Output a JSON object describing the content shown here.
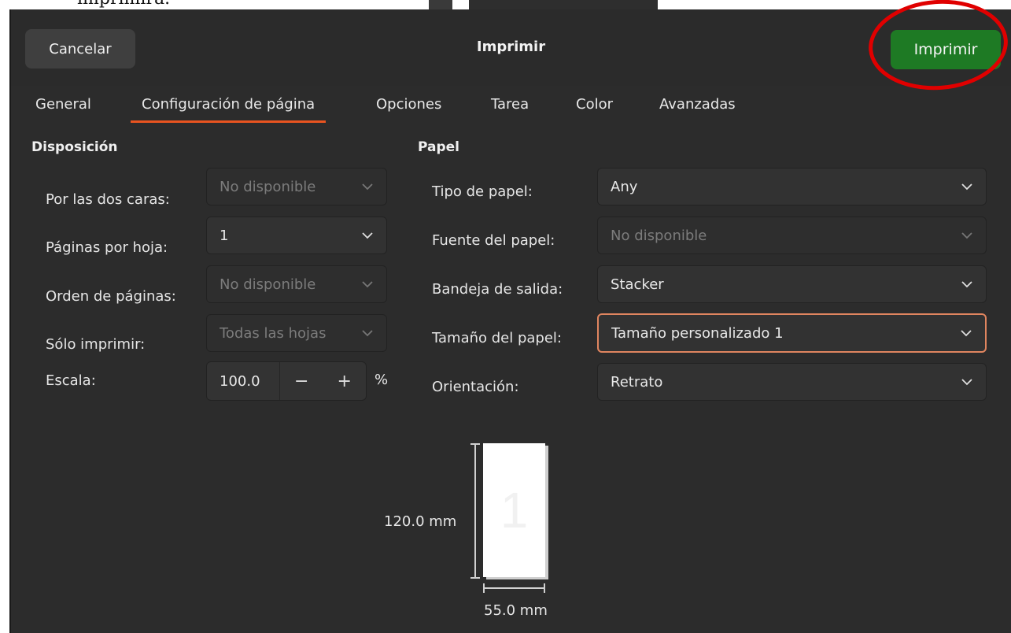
{
  "background": {
    "doc_text": "imprimirá."
  },
  "dialog": {
    "title": "Imprimir",
    "cancel_label": "Cancelar",
    "print_label": "Imprimir",
    "accent_color": "#e95420",
    "print_button_color": "#1e7a24",
    "highlight_color": "#e00000"
  },
  "tabs": [
    {
      "label": "General",
      "active": false
    },
    {
      "label": "Configuración de página",
      "active": true
    },
    {
      "label": "Opciones",
      "active": false
    },
    {
      "label": "Tarea",
      "active": false
    },
    {
      "label": "Color",
      "active": false
    },
    {
      "label": "Avanzadas",
      "active": false
    }
  ],
  "layout_section": {
    "title": "Disposición",
    "two_sided": {
      "label": "Por las dos caras:",
      "value": "No disponible",
      "disabled": true
    },
    "pages_per_sheet": {
      "label": "Páginas por hoja:",
      "value": "1",
      "disabled": false
    },
    "page_order": {
      "label": "Orden de páginas:",
      "value": "No disponible",
      "disabled": true
    },
    "only_print": {
      "label": "Sólo imprimir:",
      "value": "Todas las hojas",
      "disabled": true
    },
    "scale": {
      "label": "Escala:",
      "value": "100.0",
      "minus": "−",
      "plus": "+",
      "unit": "%"
    }
  },
  "paper_section": {
    "title": "Papel",
    "paper_type": {
      "label": "Tipo de papel:",
      "value": "Any",
      "disabled": false
    },
    "paper_source": {
      "label": "Fuente del papel:",
      "value": "No disponible",
      "disabled": true
    },
    "output_tray": {
      "label": "Bandeja de salida:",
      "value": "Stacker",
      "disabled": false
    },
    "paper_size": {
      "label": "Tamaño del papel:",
      "value": "Tamaño personalizado 1",
      "disabled": false,
      "focused": true
    },
    "orientation": {
      "label": "Orientación:",
      "value": "Retrato",
      "disabled": false
    }
  },
  "preview": {
    "page_number": "1",
    "height_label": "120.0 mm",
    "width_label": "55.0 mm"
  }
}
